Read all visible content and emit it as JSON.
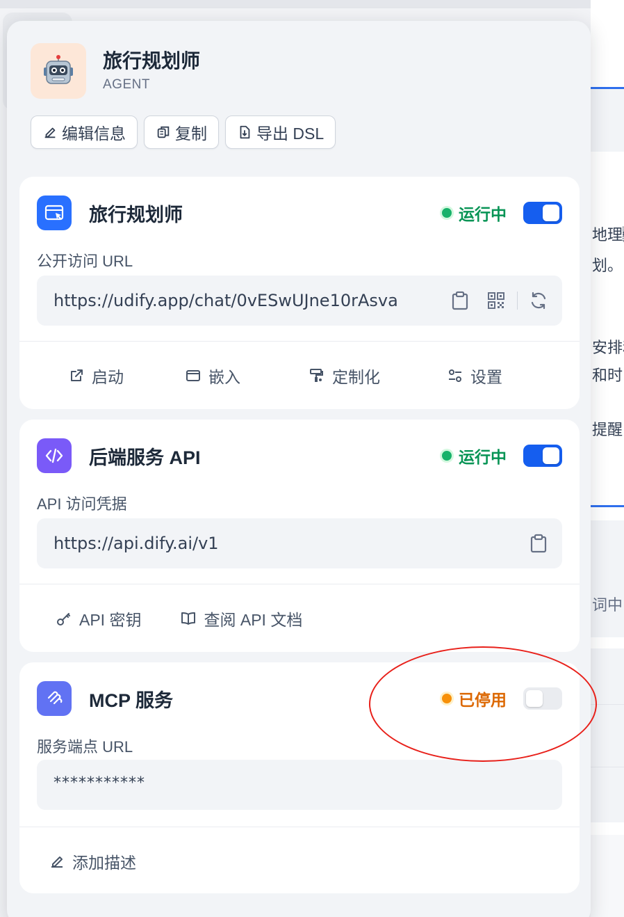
{
  "background": {
    "snippets": [
      "地理\u0007",
      "划。",
      "安排和",
      "和时",
      "提醒",
      "词中"
    ]
  },
  "app": {
    "name": "旅行规划师",
    "type": "AGENT",
    "icon": "robot-emoji"
  },
  "actions": {
    "edit": "编辑信息",
    "copy": "复制",
    "export": "导出 DSL"
  },
  "webapp": {
    "title": "旅行规划师",
    "status": "运行中",
    "enabled": true,
    "url_label": "公开访问 URL",
    "url": "https://udify.app/chat/0vESwUJne10rAsva",
    "launch": "启动",
    "embed": "嵌入",
    "customize": "定制化",
    "settings": "设置"
  },
  "api": {
    "title": "后端服务 API",
    "status": "运行中",
    "enabled": true,
    "label": "API 访问凭据",
    "url": "https://api.dify.ai/v1",
    "api_key": "API 密钥",
    "docs": "查阅 API 文档"
  },
  "mcp": {
    "title": "MCP 服务",
    "status": "已停用",
    "enabled": false,
    "label": "服务端点 URL",
    "url": "***********",
    "add_desc": "添加描述"
  },
  "colors": {
    "accent": "#155eef",
    "running": "#079455",
    "running_dot": "#17b26a",
    "disabled": "#dc6803",
    "disabled_dot": "#f79009",
    "annotation": "#e8201a"
  }
}
